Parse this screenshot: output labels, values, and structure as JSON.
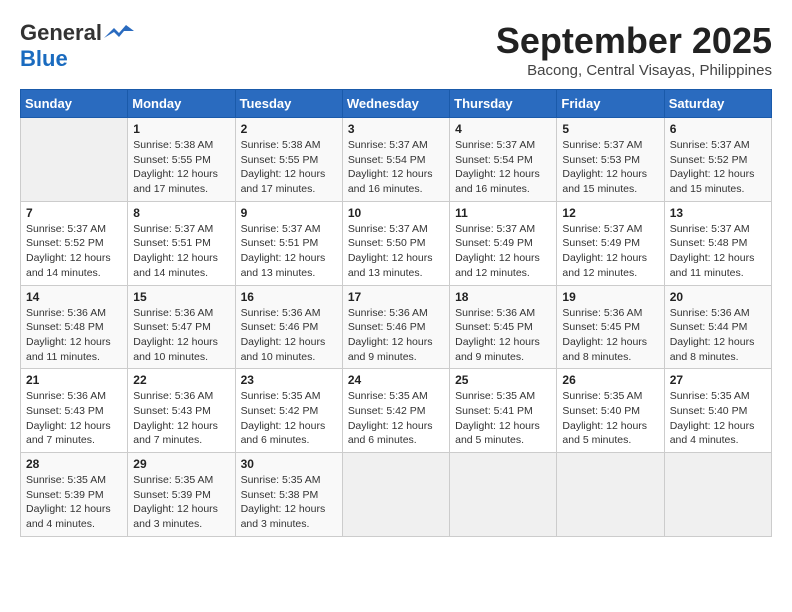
{
  "logo": {
    "general": "General",
    "blue": "Blue"
  },
  "title": "September 2025",
  "subtitle": "Bacong, Central Visayas, Philippines",
  "days_of_week": [
    "Sunday",
    "Monday",
    "Tuesday",
    "Wednesday",
    "Thursday",
    "Friday",
    "Saturday"
  ],
  "weeks": [
    [
      {
        "day": "",
        "info": ""
      },
      {
        "day": "1",
        "info": "Sunrise: 5:38 AM\nSunset: 5:55 PM\nDaylight: 12 hours\nand 17 minutes."
      },
      {
        "day": "2",
        "info": "Sunrise: 5:38 AM\nSunset: 5:55 PM\nDaylight: 12 hours\nand 17 minutes."
      },
      {
        "day": "3",
        "info": "Sunrise: 5:37 AM\nSunset: 5:54 PM\nDaylight: 12 hours\nand 16 minutes."
      },
      {
        "day": "4",
        "info": "Sunrise: 5:37 AM\nSunset: 5:54 PM\nDaylight: 12 hours\nand 16 minutes."
      },
      {
        "day": "5",
        "info": "Sunrise: 5:37 AM\nSunset: 5:53 PM\nDaylight: 12 hours\nand 15 minutes."
      },
      {
        "day": "6",
        "info": "Sunrise: 5:37 AM\nSunset: 5:52 PM\nDaylight: 12 hours\nand 15 minutes."
      }
    ],
    [
      {
        "day": "7",
        "info": "Sunrise: 5:37 AM\nSunset: 5:52 PM\nDaylight: 12 hours\nand 14 minutes."
      },
      {
        "day": "8",
        "info": "Sunrise: 5:37 AM\nSunset: 5:51 PM\nDaylight: 12 hours\nand 14 minutes."
      },
      {
        "day": "9",
        "info": "Sunrise: 5:37 AM\nSunset: 5:51 PM\nDaylight: 12 hours\nand 13 minutes."
      },
      {
        "day": "10",
        "info": "Sunrise: 5:37 AM\nSunset: 5:50 PM\nDaylight: 12 hours\nand 13 minutes."
      },
      {
        "day": "11",
        "info": "Sunrise: 5:37 AM\nSunset: 5:49 PM\nDaylight: 12 hours\nand 12 minutes."
      },
      {
        "day": "12",
        "info": "Sunrise: 5:37 AM\nSunset: 5:49 PM\nDaylight: 12 hours\nand 12 minutes."
      },
      {
        "day": "13",
        "info": "Sunrise: 5:37 AM\nSunset: 5:48 PM\nDaylight: 12 hours\nand 11 minutes."
      }
    ],
    [
      {
        "day": "14",
        "info": "Sunrise: 5:36 AM\nSunset: 5:48 PM\nDaylight: 12 hours\nand 11 minutes."
      },
      {
        "day": "15",
        "info": "Sunrise: 5:36 AM\nSunset: 5:47 PM\nDaylight: 12 hours\nand 10 minutes."
      },
      {
        "day": "16",
        "info": "Sunrise: 5:36 AM\nSunset: 5:46 PM\nDaylight: 12 hours\nand 10 minutes."
      },
      {
        "day": "17",
        "info": "Sunrise: 5:36 AM\nSunset: 5:46 PM\nDaylight: 12 hours\nand 9 minutes."
      },
      {
        "day": "18",
        "info": "Sunrise: 5:36 AM\nSunset: 5:45 PM\nDaylight: 12 hours\nand 9 minutes."
      },
      {
        "day": "19",
        "info": "Sunrise: 5:36 AM\nSunset: 5:45 PM\nDaylight: 12 hours\nand 8 minutes."
      },
      {
        "day": "20",
        "info": "Sunrise: 5:36 AM\nSunset: 5:44 PM\nDaylight: 12 hours\nand 8 minutes."
      }
    ],
    [
      {
        "day": "21",
        "info": "Sunrise: 5:36 AM\nSunset: 5:43 PM\nDaylight: 12 hours\nand 7 minutes."
      },
      {
        "day": "22",
        "info": "Sunrise: 5:36 AM\nSunset: 5:43 PM\nDaylight: 12 hours\nand 7 minutes."
      },
      {
        "day": "23",
        "info": "Sunrise: 5:35 AM\nSunset: 5:42 PM\nDaylight: 12 hours\nand 6 minutes."
      },
      {
        "day": "24",
        "info": "Sunrise: 5:35 AM\nSunset: 5:42 PM\nDaylight: 12 hours\nand 6 minutes."
      },
      {
        "day": "25",
        "info": "Sunrise: 5:35 AM\nSunset: 5:41 PM\nDaylight: 12 hours\nand 5 minutes."
      },
      {
        "day": "26",
        "info": "Sunrise: 5:35 AM\nSunset: 5:40 PM\nDaylight: 12 hours\nand 5 minutes."
      },
      {
        "day": "27",
        "info": "Sunrise: 5:35 AM\nSunset: 5:40 PM\nDaylight: 12 hours\nand 4 minutes."
      }
    ],
    [
      {
        "day": "28",
        "info": "Sunrise: 5:35 AM\nSunset: 5:39 PM\nDaylight: 12 hours\nand 4 minutes."
      },
      {
        "day": "29",
        "info": "Sunrise: 5:35 AM\nSunset: 5:39 PM\nDaylight: 12 hours\nand 3 minutes."
      },
      {
        "day": "30",
        "info": "Sunrise: 5:35 AM\nSunset: 5:38 PM\nDaylight: 12 hours\nand 3 minutes."
      },
      {
        "day": "",
        "info": ""
      },
      {
        "day": "",
        "info": ""
      },
      {
        "day": "",
        "info": ""
      },
      {
        "day": "",
        "info": ""
      }
    ]
  ]
}
